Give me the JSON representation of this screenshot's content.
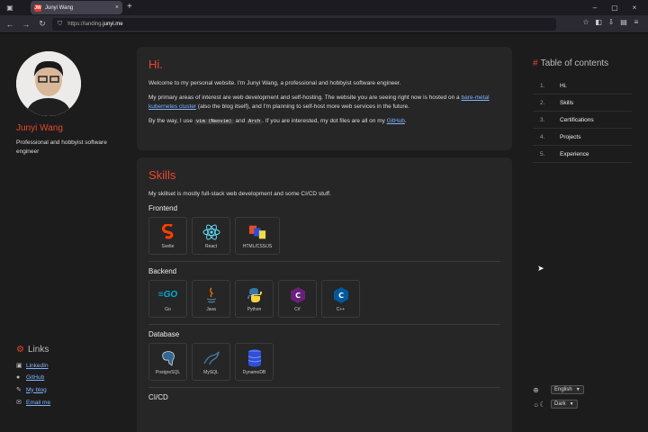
{
  "browser": {
    "tab_title": "Junyi Wang",
    "tab_favicon": "JW",
    "url_prefix": "https://landing.",
    "url_host": "junyi.me"
  },
  "profile": {
    "name": "Junyi Wang",
    "description": "Professional and hobbyist software engineer"
  },
  "links": {
    "heading": "Links",
    "items": [
      {
        "icon": "linkedin-icon",
        "label": "LinkedIn"
      },
      {
        "icon": "github-icon",
        "label": "GitHub"
      },
      {
        "icon": "feather-icon",
        "label": "My blog"
      },
      {
        "icon": "mail-icon",
        "label": "Email me"
      }
    ]
  },
  "intro": {
    "title": "Hi.",
    "p1": "Welcome to my personal website. I'm Junyi Wang, a professional and hobbyist software engineer.",
    "p2a": "My primary areas of interest are web development and self-hosting. The website you are seeing right now is hosted on a ",
    "p2_link": "bare-metal kubernetes cluster",
    "p2b": " (also the blog itself), and I'm planning to self-host more web services in the future.",
    "p3a": "By the way, I use ",
    "code1": "vim (Neovim)",
    "p3and": " and ",
    "code2": "Arch",
    "p3b": ". If you are interested, my dot files are all on my ",
    "p3_link": "GitHub",
    "p3c": "."
  },
  "skills": {
    "title": "Skills",
    "desc": "My skillset is mostly full-stack web development and some CI/CD stuff.",
    "frontend_label": "Frontend",
    "frontend": [
      "Svelte",
      "React",
      "HTML/CSS/JS"
    ],
    "backend_label": "Backend",
    "backend": [
      "Go",
      "Java",
      "Python",
      "C#",
      "C++"
    ],
    "database_label": "Database",
    "database": [
      "PostgreSQL",
      "MySQL",
      "DynamoDB"
    ],
    "cicd_label": "CI/CD"
  },
  "toc": {
    "heading": "Table of contents",
    "items": [
      {
        "num": "1.",
        "label": "Hi."
      },
      {
        "num": "2.",
        "label": "Skills"
      },
      {
        "num": "3.",
        "label": "Certifications"
      },
      {
        "num": "4.",
        "label": "Projects"
      },
      {
        "num": "5.",
        "label": "Experience"
      }
    ]
  },
  "settings": {
    "language": "English",
    "theme": "Dark"
  },
  "colors": {
    "accent": "#e8472f",
    "link": "#7fb3ff"
  }
}
